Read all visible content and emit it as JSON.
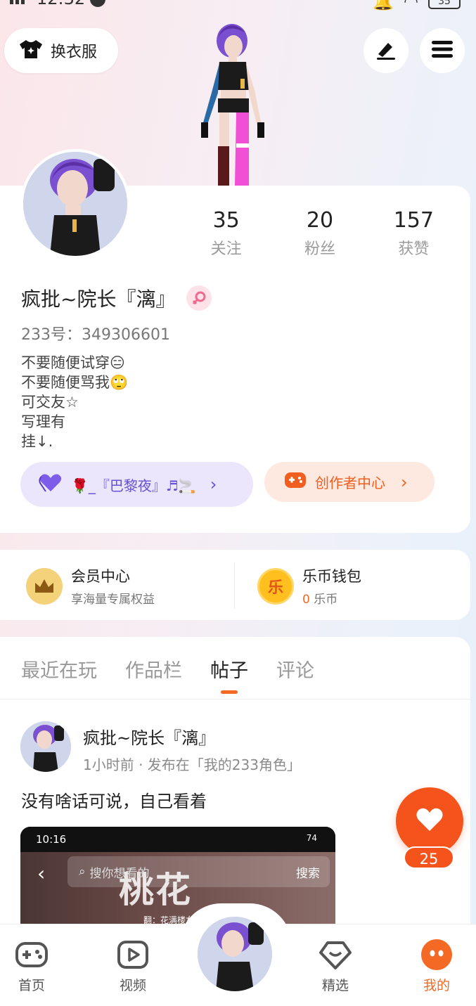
{
  "status_bar": {
    "time": "12:32",
    "battery": "35"
  },
  "top": {
    "dress_label": "换衣服"
  },
  "profile": {
    "stats": [
      {
        "num": "35",
        "label": "关注"
      },
      {
        "num": "20",
        "label": "粉丝"
      },
      {
        "num": "157",
        "label": "获赞"
      }
    ],
    "username": "疯批~院长『漓』",
    "uid": "233号：349306601",
    "bio": [
      "不要随便试穿😑",
      "不要随便骂我🙄",
      "可交友☆",
      "写理有",
      "挂↓."
    ],
    "music": "🌹_『巴黎夜』♬🚬",
    "creator": "创作者中心"
  },
  "member": {
    "vip_title": "会员中心",
    "vip_sub": "享海量专属权益",
    "wallet_title": "乐币钱包",
    "wallet_amount": "0",
    "wallet_unit": "乐币",
    "coin_char": "乐"
  },
  "tabs": [
    "最近在玩",
    "作品栏",
    "帖子",
    "评论"
  ],
  "post": {
    "name": "疯批~院长『漓』",
    "meta": "1小时前 · 发布在「我的233角色」",
    "text": "没有啥话可说，自己看着",
    "shot_time": "10:16",
    "shot_battery": "74",
    "shot_search_placeholder": "搜你想看的",
    "shot_search_btn": "搜索",
    "shot_title": "桃花",
    "shot_sub": "翻：花满楼女团"
  },
  "like_count": "25",
  "nav": [
    {
      "label": "首页"
    },
    {
      "label": "视频"
    },
    {
      "label": "精选"
    },
    {
      "label": "我的"
    }
  ],
  "colors": {
    "accent": "#f46a24",
    "like": "#f4541b",
    "music": "#6a4fd7"
  }
}
